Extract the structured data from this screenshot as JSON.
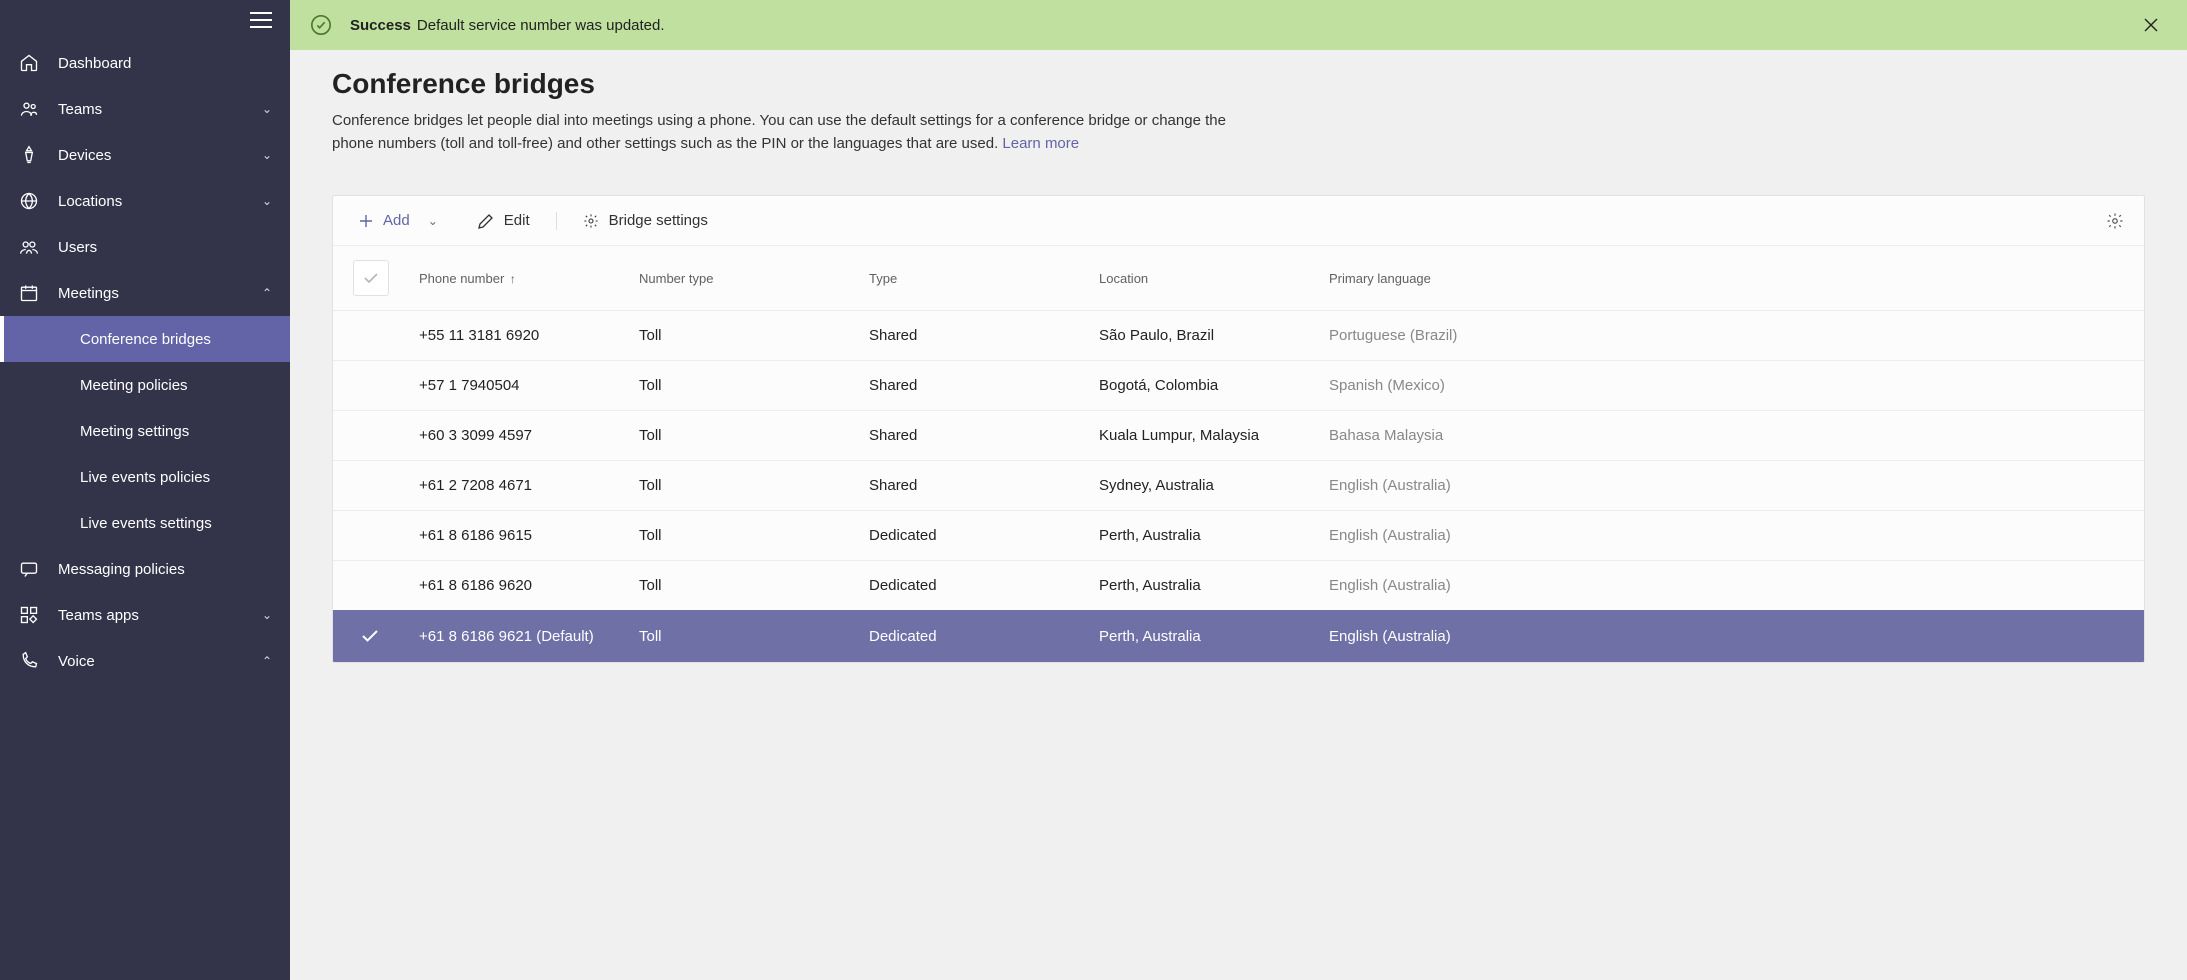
{
  "banner": {
    "strong": "Success",
    "text": "Default service number was updated."
  },
  "page": {
    "title": "Conference bridges",
    "description": "Conference bridges let people dial into meetings using a phone. You can use the default settings for a conference bridge or change the phone numbers (toll and toll-free) and other settings such as the PIN or the languages that are used. ",
    "learn_more": "Learn more"
  },
  "sidebar": {
    "dashboard": "Dashboard",
    "teams": "Teams",
    "devices": "Devices",
    "locations": "Locations",
    "users": "Users",
    "meetings": "Meetings",
    "meetings_sub": {
      "conference_bridges": "Conference bridges",
      "meeting_policies": "Meeting policies",
      "meeting_settings": "Meeting settings",
      "live_events_policies": "Live events policies",
      "live_events_settings": "Live events settings"
    },
    "messaging_policies": "Messaging policies",
    "teams_apps": "Teams apps",
    "voice": "Voice"
  },
  "toolbar": {
    "add": "Add",
    "edit": "Edit",
    "bridge_settings": "Bridge settings"
  },
  "table": {
    "headers": {
      "phone": "Phone number",
      "number_type": "Number type",
      "type": "Type",
      "location": "Location",
      "language": "Primary language"
    },
    "rows": [
      {
        "phone": "+55 11 3181 6920",
        "ntype": "Toll",
        "type": "Shared",
        "location": "São Paulo, Brazil",
        "language": "Portuguese (Brazil)",
        "selected": false
      },
      {
        "phone": "+57 1 7940504",
        "ntype": "Toll",
        "type": "Shared",
        "location": "Bogotá, Colombia",
        "language": "Spanish (Mexico)",
        "selected": false
      },
      {
        "phone": "+60 3 3099 4597",
        "ntype": "Toll",
        "type": "Shared",
        "location": "Kuala Lumpur, Malaysia",
        "language": "Bahasa Malaysia",
        "selected": false
      },
      {
        "phone": "+61 2 7208 4671",
        "ntype": "Toll",
        "type": "Shared",
        "location": "Sydney, Australia",
        "language": "English (Australia)",
        "selected": false
      },
      {
        "phone": "+61 8 6186 9615",
        "ntype": "Toll",
        "type": "Dedicated",
        "location": "Perth, Australia",
        "language": "English (Australia)",
        "selected": false
      },
      {
        "phone": "+61 8 6186 9620",
        "ntype": "Toll",
        "type": "Dedicated",
        "location": "Perth, Australia",
        "language": "English (Australia)",
        "selected": false
      },
      {
        "phone": "+61 8 6186 9621 (Default)",
        "ntype": "Toll",
        "type": "Dedicated",
        "location": "Perth, Australia",
        "language": "English (Australia)",
        "selected": true
      }
    ]
  }
}
